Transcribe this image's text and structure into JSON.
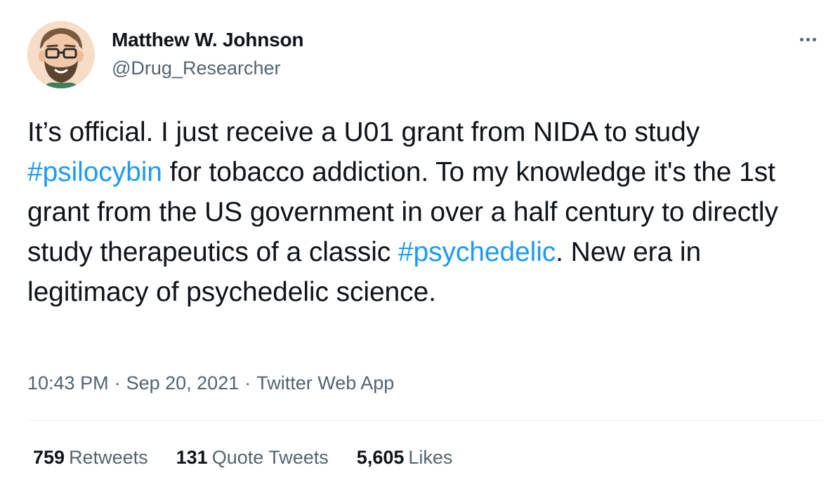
{
  "author": {
    "display_name": "Matthew W. Johnson",
    "handle": "@Drug_Researcher"
  },
  "tweet": {
    "segments": [
      {
        "text": "It’s official. I just receive a U01 grant from NIDA to study ",
        "type": "text"
      },
      {
        "text": "#psilocybin",
        "type": "hashtag"
      },
      {
        "text": " for tobacco addiction. To my knowledge it's the 1st grant from the US government in over a half century to directly study therapeutics of a classic ",
        "type": "text"
      },
      {
        "text": "#psychedelic",
        "type": "hashtag"
      },
      {
        "text": ". New era in legitimacy of psychedelic science.",
        "type": "text"
      }
    ]
  },
  "meta": {
    "time": "10:43 PM",
    "separator": "·",
    "date": "Sep 20, 2021",
    "source": "Twitter Web App"
  },
  "stats": {
    "retweets_count": "759",
    "retweets_label": "Retweets",
    "quotes_count": "131",
    "quotes_label": "Quote Tweets",
    "likes_count": "5,605",
    "likes_label": "Likes"
  },
  "icons": {
    "more": "more-horizontal-icon"
  },
  "colors": {
    "text": "#0f1419",
    "secondary": "#536471",
    "link": "#1d9bf0",
    "divider": "#eff3f4"
  }
}
